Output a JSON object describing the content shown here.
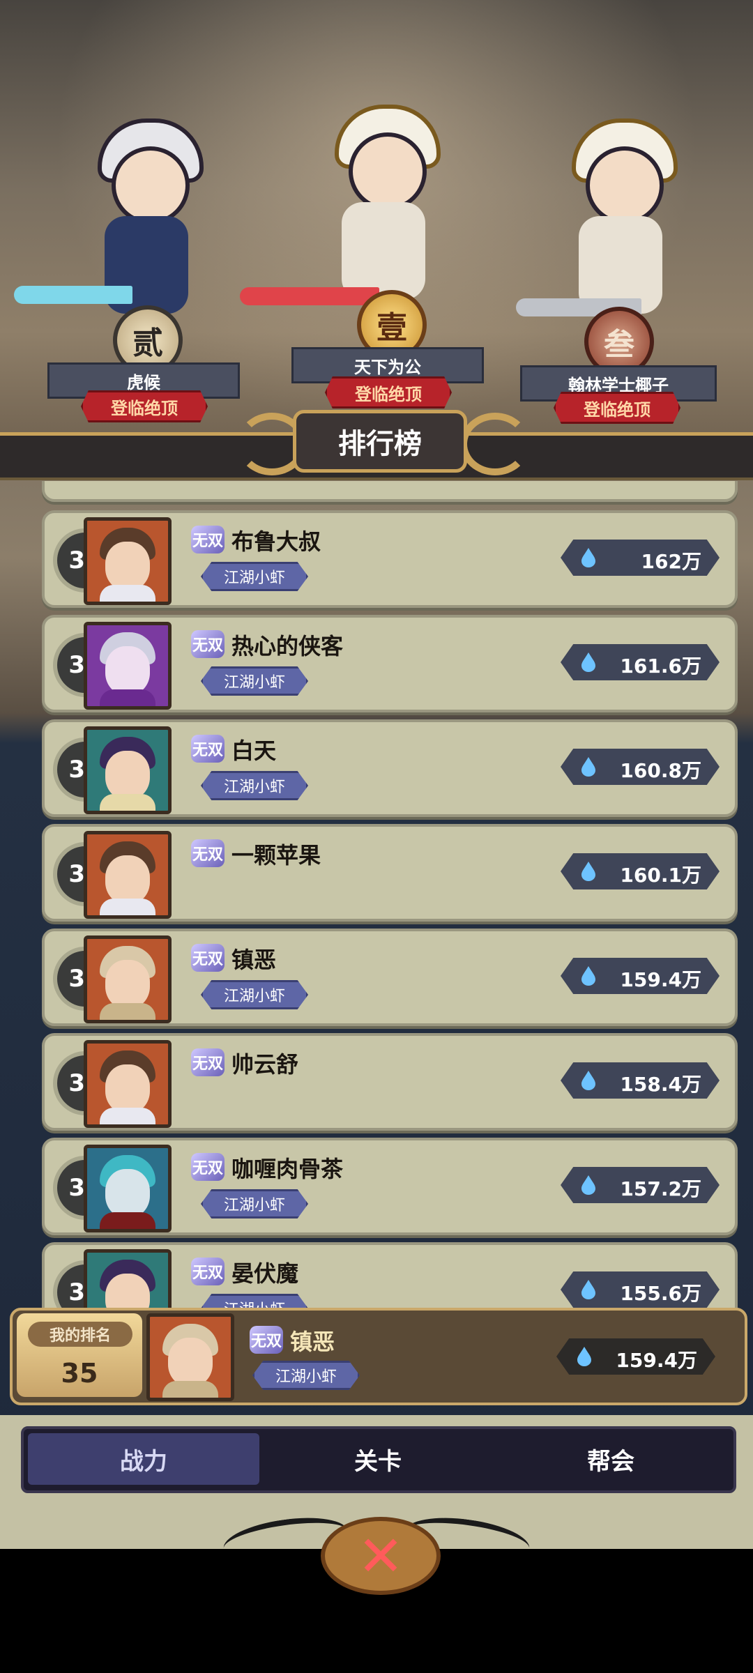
{
  "podium": {
    "second": {
      "medal": "贰",
      "name": "虎候",
      "tag": "登临绝顶"
    },
    "first": {
      "medal": "壹",
      "name": "天下为公",
      "tag": "登临绝顶"
    },
    "third": {
      "medal": "叁",
      "name": "翰林学士椰子",
      "tag": "登临绝顶"
    },
    "board_title": "排行榜"
  },
  "rows": [
    {
      "rank": "31",
      "badge": "无双",
      "name": "布鲁大叔",
      "title": "江湖小虾",
      "power": "162万"
    },
    {
      "rank": "32",
      "badge": "无双",
      "name": "热心的侠客",
      "title": "江湖小虾",
      "power": "161.6万"
    },
    {
      "rank": "33",
      "badge": "无双",
      "name": "白天",
      "title": "江湖小虾",
      "power": "160.8万"
    },
    {
      "rank": "34",
      "badge": "无双",
      "name": "一颗苹果",
      "title": "",
      "power": "160.1万"
    },
    {
      "rank": "35",
      "badge": "无双",
      "name": "镇恶",
      "title": "江湖小虾",
      "power": "159.4万"
    },
    {
      "rank": "36",
      "badge": "无双",
      "name": "帅云舒",
      "title": "",
      "power": "158.4万"
    },
    {
      "rank": "37",
      "badge": "无双",
      "name": "咖喱肉骨茶",
      "title": "江湖小虾",
      "power": "157.2万"
    },
    {
      "rank": "38",
      "badge": "无双",
      "name": "晏伏魔",
      "title": "江湖小虾",
      "power": "155.6万"
    }
  ],
  "my_rank": {
    "label": "我的排名",
    "rank": "35",
    "badge": "无双",
    "name": "镇恶",
    "title": "江湖小虾",
    "power": "159.4万"
  },
  "tabs": [
    {
      "label": "战力",
      "active": true
    },
    {
      "label": "关卡",
      "active": false
    },
    {
      "label": "帮会",
      "active": false
    }
  ],
  "colors": {
    "accent": "#c9a25a",
    "row_bg": "#c8c6a8",
    "crown_red": "#b7232a",
    "tab_active": "#3e3f6e"
  },
  "icons": {
    "power": "flame-drop-icon",
    "close": "close-x-icon"
  }
}
